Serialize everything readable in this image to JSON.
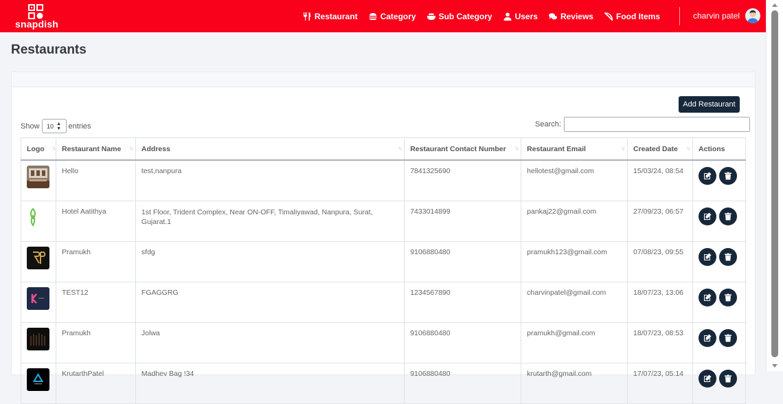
{
  "brand": {
    "name": "snapdish",
    "color": "#f9001b"
  },
  "nav": {
    "items": [
      {
        "label": "Restaurant",
        "icon": "utensils-icon"
      },
      {
        "label": "Category",
        "icon": "burger-icon"
      },
      {
        "label": "Sub Category",
        "icon": "bowl-icon"
      },
      {
        "label": "Users",
        "icon": "user-icon"
      },
      {
        "label": "Reviews",
        "icon": "comments-icon"
      },
      {
        "label": "Food Items",
        "icon": "pizza-icon"
      }
    ],
    "user_name": "charvin patel"
  },
  "page": {
    "title": "Restaurants"
  },
  "toolbar": {
    "add_label": "Add Restaurant",
    "show_label": "Show",
    "entries_value": "10",
    "entries_label": "entries",
    "search_label": "Search:",
    "search_value": ""
  },
  "table": {
    "columns": [
      "Logo",
      "Restaurant Name",
      "Address",
      "Restaurant Contact Number",
      "Restaurant Email",
      "Created Date",
      "Actions"
    ],
    "rows": [
      {
        "name": "Hello",
        "address": "test,nanpura",
        "contact": "7841325690",
        "email": "hellotest@gmail.com",
        "created": "15/03/24, 08:54",
        "logo": "interior"
      },
      {
        "name": "Hotel Aatithya",
        "address": "1st Floor, Trident Complex, Near ON-OFF, Timaliyawad, Nanpura, Surat, Gujarat.1",
        "contact": "7433014899",
        "email": "pankaj22@gmail.com",
        "created": "27/09/23, 06:57",
        "logo": "leaf"
      },
      {
        "name": "Pramukh",
        "address": "sfdg",
        "contact": "9106880480",
        "email": "pramukh123@gmail.com",
        "created": "07/08/23, 09:55",
        "logo": "monogram"
      },
      {
        "name": "TEST12",
        "address": "FGAGGRG",
        "contact": "1234567890",
        "email": "charvinpatel@gmail.com",
        "created": "18/07/23, 13:06",
        "logo": "k-letter"
      },
      {
        "name": "Pramukh",
        "address": "Jolwa",
        "contact": "9106880480",
        "email": "pramukh@gmail.com",
        "created": "18/07/23, 08:53",
        "logo": "dark"
      },
      {
        "name": "KrutarthPatel",
        "address": "Madhev Bag !34",
        "contact": "9106880480",
        "email": "krutarth@gmail.com",
        "created": "17/07/23, 05:14",
        "logo": "triangle"
      }
    ]
  },
  "icons": {
    "edit": "edit-icon",
    "delete": "trash-icon"
  }
}
